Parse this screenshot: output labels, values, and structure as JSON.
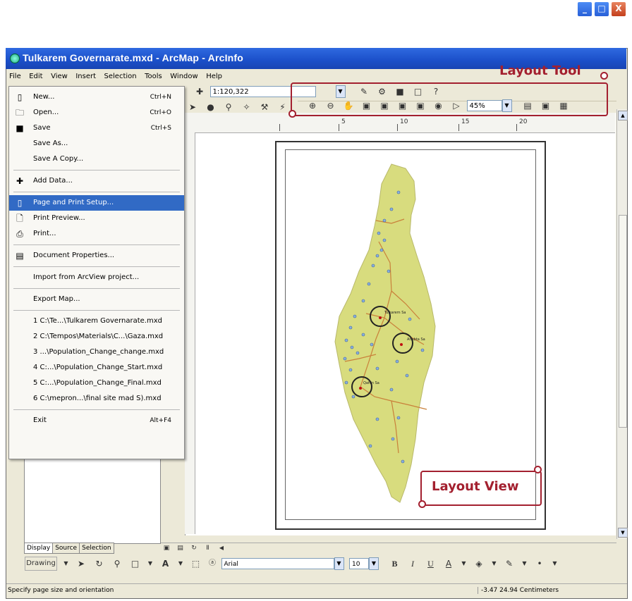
{
  "window": {
    "title": "Tulkarem Governarate.mxd - ArcMap - ArcInfo",
    "buttons": [
      "_",
      "□",
      "X"
    ]
  },
  "menubar": {
    "items": [
      "File",
      "Edit",
      "View",
      "Insert",
      "Selection",
      "Tools",
      "Window",
      "Help"
    ]
  },
  "toolbar": {
    "scale_value": "1:120,322",
    "zoom_value": "45%"
  },
  "file_menu": {
    "items": [
      {
        "label": "New...",
        "shortcut": "Ctrl+N",
        "icon": "new-doc-icon"
      },
      {
        "label": "Open...",
        "shortcut": "Ctrl+O",
        "icon": "open-folder-icon"
      },
      {
        "label": "Save",
        "shortcut": "Ctrl+S",
        "icon": "save-disk-icon"
      },
      {
        "label": "Save As...",
        "shortcut": "",
        "icon": ""
      },
      {
        "label": "Save A Copy...",
        "shortcut": "",
        "icon": ""
      },
      {
        "label": "Add Data...",
        "shortcut": "",
        "icon": "add-data-icon"
      },
      {
        "label": "Page and Print Setup...",
        "shortcut": "",
        "icon": "page-setup-icon"
      },
      {
        "label": "Print Preview...",
        "shortcut": "",
        "icon": "print-preview-icon"
      },
      {
        "label": "Print...",
        "shortcut": "",
        "icon": "print-icon"
      },
      {
        "label": "Document Properties...",
        "shortcut": "",
        "icon": "document-properties-icon"
      },
      {
        "label": "Import from ArcView project...",
        "shortcut": "",
        "icon": ""
      },
      {
        "label": "Export Map...",
        "shortcut": "",
        "icon": ""
      },
      {
        "label": "1 C:\\Te...\\Tulkarem Governarate.mxd",
        "shortcut": "",
        "icon": ""
      },
      {
        "label": "2 C:\\Tempos\\Materials\\C...\\Gaza.mxd",
        "shortcut": "",
        "icon": ""
      },
      {
        "label": "3 ...\\Population_Change_change.mxd",
        "shortcut": "",
        "icon": ""
      },
      {
        "label": "4 C:...\\Population_Change_Start.mxd",
        "shortcut": "",
        "icon": ""
      },
      {
        "label": "5 C:...\\Population_Change_Final.mxd",
        "shortcut": "",
        "icon": ""
      },
      {
        "label": "6 C:\\mepron...\\final site mad S).mxd",
        "shortcut": "",
        "icon": ""
      },
      {
        "label": "Exit",
        "shortcut": "Alt+F4",
        "icon": ""
      }
    ]
  },
  "toc_tabs": [
    "Display",
    "Source",
    "Selection"
  ],
  "ruler_labels": [
    "5",
    "10",
    "15",
    "20"
  ],
  "map_labels": [
    "Tulkarem Sa",
    "Anabta Sa",
    "Qaffin Sa"
  ],
  "drawing_bar": {
    "drawing_label": "Drawing",
    "font_name": "Arial",
    "font_size": "10"
  },
  "status": {
    "message": "Specify page size and orientation",
    "coordinates": "-3.47  24.94 Centimeters"
  },
  "annotations": {
    "layout_tool": "Layout Tool",
    "layout_view": "Layout View",
    "color": "#a3202f"
  }
}
